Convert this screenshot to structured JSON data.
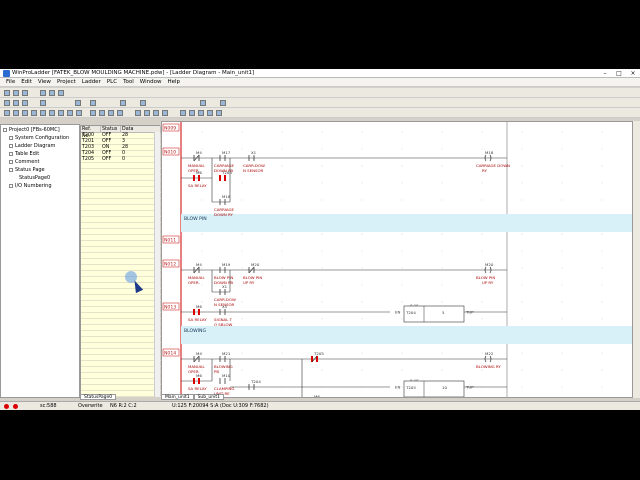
{
  "title": "WinProLadder [FATEK_BLOW MOULDING MACHINE.pdw] - [Ladder Diagram - Main_unit1]",
  "menu": [
    "File",
    "Edit",
    "View",
    "Project",
    "Ladder",
    "PLC",
    "Tool",
    "Window",
    "Help"
  ],
  "tree": [
    {
      "label": "Project0 [FBs-60MC]"
    },
    {
      "label": "System Configuration"
    },
    {
      "label": "Ladder Diagram"
    },
    {
      "label": "Table Edit"
    },
    {
      "label": "Comment"
    },
    {
      "label": "Status Page"
    },
    {
      "label": "StatusPage0"
    },
    {
      "label": "I/O Numbering"
    }
  ],
  "status_table": {
    "headers": [
      "Ref. No.",
      "Status",
      "Data"
    ],
    "rows": [
      [
        "T200",
        "OFF",
        "28"
      ],
      [
        "T201",
        "OFF",
        "3"
      ],
      [
        "T203",
        "ON",
        "28"
      ],
      [
        "T204",
        "OFF",
        "0"
      ],
      [
        "T205",
        "OFF",
        "0"
      ]
    ]
  },
  "status_tab": "StatusPage0",
  "bottom_tabs": [
    "Main_unit1",
    "Sub_unit1"
  ],
  "statusbar": {
    "count": "sc:588",
    "mode": "Overwrite",
    "pos": "N6 R:2 C:2",
    "ref": "U:125 F:20094 S:A (Doc U:309 F:7682)"
  },
  "ladder": {
    "networks": [
      "N009",
      "N010",
      "N011",
      "N012",
      "N013",
      "N014"
    ],
    "comments": [
      "BLOW PIN",
      "BLOWING"
    ],
    "contacts": [
      {
        "id": "M4",
        "label": "MANUAL OPER."
      },
      {
        "id": "M17",
        "label": "CARRIAGE DOWN PB"
      },
      {
        "id": "X1",
        "label": "CARR.DOW N SENSOR"
      },
      {
        "id": "M6",
        "label": "SA RELAY"
      },
      {
        "id": "T203",
        "label": ""
      },
      {
        "id": "M18",
        "label": "CARRIAGE DOWN RY"
      },
      {
        "id": "M19",
        "label": "BLOW PIN DOWN PB"
      },
      {
        "id": "M20",
        "label": "BLOW PIN UP RY"
      },
      {
        "id": "X1",
        "label": "CARR.DOW N SENSOR"
      },
      {
        "id": "X5",
        "label": "SIGNAL T O SBLOW"
      },
      {
        "id": "M21",
        "label": "BLOWING PB"
      },
      {
        "id": "M10",
        "label": "CLAMPING UNIT RE"
      },
      {
        "id": "T204",
        "label": ""
      },
      {
        "id": "T205",
        "label": ""
      },
      {
        "id": "M6",
        "label": "SA RELAY"
      }
    ],
    "coils": [
      {
        "id": "M18",
        "label": "CARRIAGE DOWN RY"
      },
      {
        "id": "M20",
        "label": "BLOW PIN UP RY"
      },
      {
        "id": "M22",
        "label": "BLOWING RY"
      }
    ],
    "timers": [
      {
        "name": "T204",
        "preset": "5",
        "base": "0.1S"
      },
      {
        "name": "T205",
        "preset": "10",
        "base": "0.1S"
      }
    ],
    "tup": "TUP"
  }
}
